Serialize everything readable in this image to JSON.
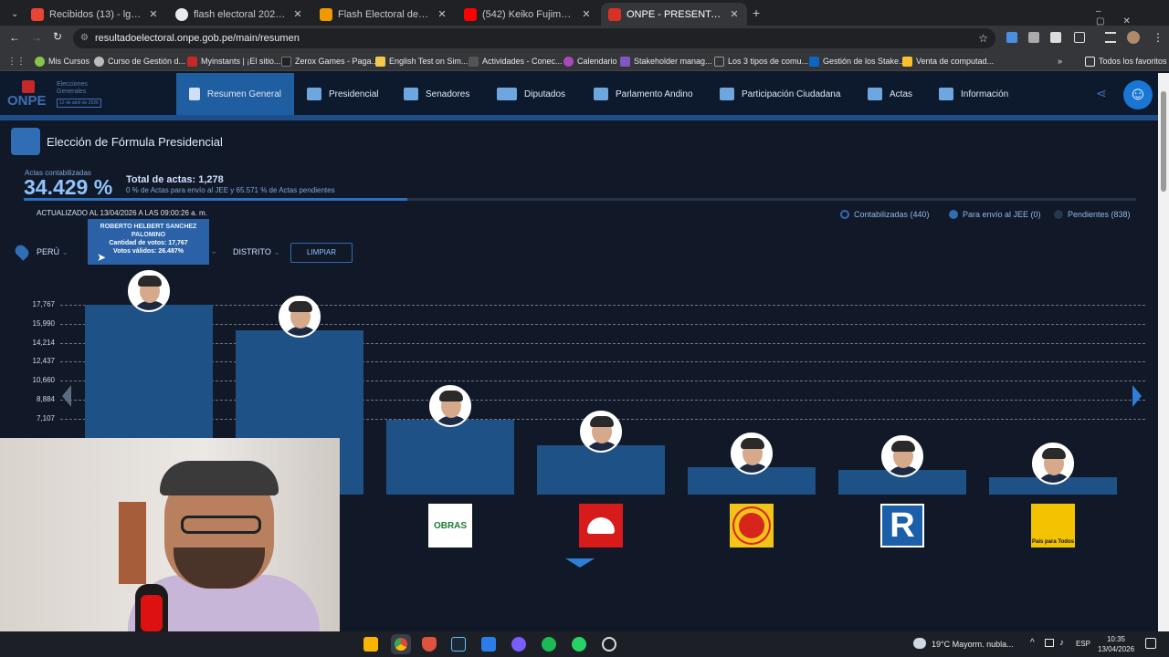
{
  "browser": {
    "tabs": [
      {
        "label": "Recibidos (13) - lgarciad30@gm",
        "color": "#ea4335"
      },
      {
        "label": "flash electoral 2026 - Buscar co",
        "color": "#e8eaed"
      },
      {
        "label": "Flash Electoral de Datum EN VI",
        "color": "#f29900"
      },
      {
        "label": "(542) Keiko Fujimori y Rafael Ló",
        "color": "#ff0000"
      },
      {
        "label": "ONPE - PRESENTACIÓN DE RES",
        "color": "#d93025"
      }
    ],
    "url": "resultadoelectoral.onpe.gob.pe/main/resumen",
    "bookmarks": [
      "Mis Cursos",
      "Curso de Gestión d...",
      "Myinstants | ¡El sitio...",
      "Zerox Games - Paga...",
      "English Test on Sim...",
      "Actividades - Conec...",
      "Calendario",
      "Stakeholder manag...",
      "Los 3 tipos de comu...",
      "Gestión de los Stake...",
      "Venta de computad..."
    ],
    "bookmarks_all": "Todos los favoritos"
  },
  "app": {
    "logo": "ONPE",
    "logo_sub": "Elecciones Generales",
    "logo_date": "12 de abril de 2026",
    "nav": [
      "Resumen General",
      "Presidencial",
      "Senadores",
      "Diputados",
      "Parlamento Andino",
      "Participación Ciudadana",
      "Actas",
      "Información"
    ],
    "section_title": "Elección de Fórmula Presidencial",
    "actas_label": "Actas contabilizadas",
    "actas_pct": "34.429 %",
    "total_actas": "Total de actas: 1,278",
    "actas_sub": "0 % de Actas para envío al JEE y 65.571 % de Actas pendientes",
    "updated": "ACTUALIZADO AL 13/04/2026 A LAS 09:00:26 a. m.",
    "legend": [
      "Contabilizadas (440)",
      "Para envío al JEE (0)",
      "Pendientes (838)"
    ],
    "filters": {
      "peru": "PERÚ",
      "distrito": "DISTRITO",
      "limpiar": "LIMPIAR"
    },
    "tooltip": {
      "name": "ROBERTO HELBERT SANCHEZ PALOMINO",
      "votes": "Cantidad de votos: 17,767",
      "valid": "Votos válidos: 26.487%"
    },
    "party_logos": [
      "OBRAS",
      "",
      "",
      "R",
      "País para Todos"
    ]
  },
  "chart_data": {
    "type": "bar",
    "categories": [
      "ROBERTO HELBERT SANCHEZ PALOMINO",
      "",
      "",
      "",
      "",
      "",
      ""
    ],
    "values": [
      17767,
      15400,
      7000,
      4600,
      2600,
      2300,
      1650
    ],
    "yticks": [
      "17,767",
      "15,990",
      "14,214",
      "12,437",
      "10,660",
      "8,884",
      "7,107"
    ],
    "ylim": [
      0,
      19000
    ]
  },
  "colors": {
    "bar": "#1e5286",
    "accent": "#1f5ea0",
    "bg": "#111827"
  },
  "system": {
    "weather": "19°C  Mayorm. nubla...",
    "lang": "ESP",
    "time": "10:35",
    "date": "13/04/2026"
  }
}
